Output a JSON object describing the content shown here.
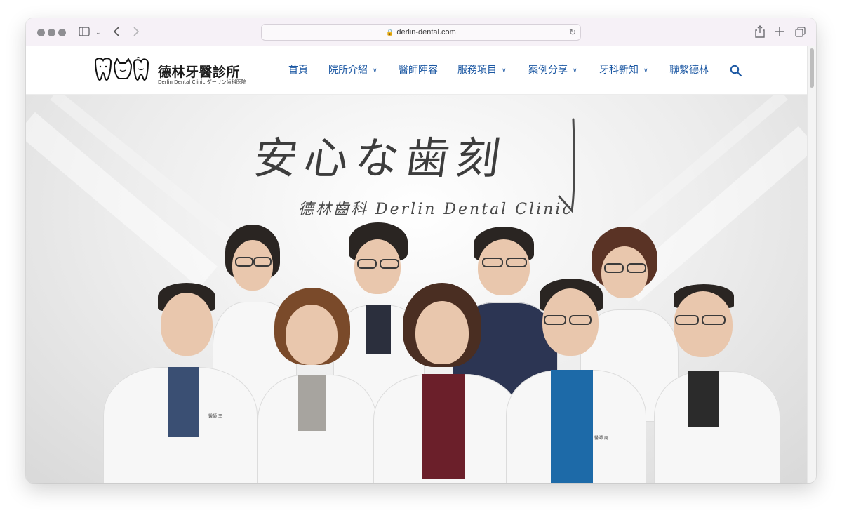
{
  "browser": {
    "url": "derlin-dental.com"
  },
  "site": {
    "logo_name": "德林牙醫診所",
    "logo_subtitle": "Derlin Dental Clinic ダーリン歯科医院",
    "nav": [
      {
        "label": "首頁",
        "has_dropdown": false
      },
      {
        "label": "院所介紹",
        "has_dropdown": true
      },
      {
        "label": "醫師陣容",
        "has_dropdown": false
      },
      {
        "label": "服務項目",
        "has_dropdown": true
      },
      {
        "label": "案例分享",
        "has_dropdown": true
      },
      {
        "label": "牙科新知",
        "has_dropdown": true
      },
      {
        "label": "聯繫德林",
        "has_dropdown": false
      }
    ],
    "accent_color": "#1c58a3"
  },
  "hero": {
    "tagline": "安心な歯刻",
    "clinic_line": "德林齒科 Derlin Dental Clinic"
  }
}
